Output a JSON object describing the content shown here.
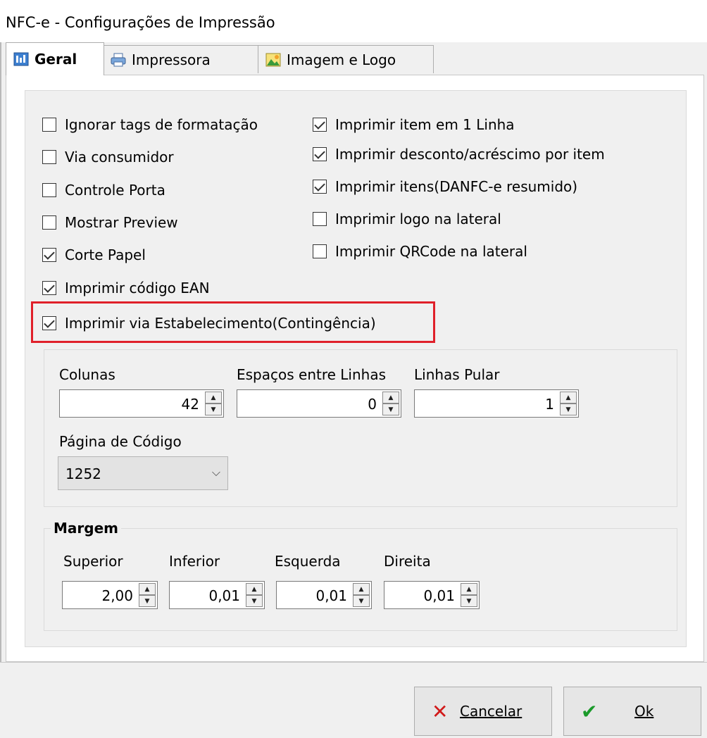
{
  "window": {
    "title": "NFC-e - Configurações de Impressão"
  },
  "tabs": [
    {
      "label": "Geral",
      "icon": "settings-grid-icon",
      "active": true
    },
    {
      "label": "Impressora",
      "icon": "printer-icon",
      "active": false
    },
    {
      "label": "Imagem e Logo",
      "icon": "image-icon",
      "active": false
    }
  ],
  "options": {
    "ignorar_tags": {
      "label": "Ignorar tags de formatação",
      "checked": false
    },
    "via_consumidor": {
      "label": "Via consumidor",
      "checked": false
    },
    "controle_porta": {
      "label": "Controle Porta",
      "checked": false
    },
    "mostrar_preview": {
      "label": "Mostrar Preview",
      "checked": false
    },
    "corte_papel": {
      "label": "Corte Papel",
      "checked": true
    },
    "imprimir_ean": {
      "label": "Imprimir código EAN",
      "checked": true
    },
    "imprimir_via_estab": {
      "label": "Imprimir via Estabelecimento(Contingência)",
      "checked": true
    },
    "imprimir_item_1_linha": {
      "label": "Imprimir item em 1 Linha",
      "checked": true
    },
    "imprimir_desconto": {
      "label": "Imprimir desconto/acréscimo por item",
      "checked": true
    },
    "imprimir_itens_resumido": {
      "label": "Imprimir itens(DANFC-e resumido)",
      "checked": true
    },
    "imprimir_logo_lateral": {
      "label": "Imprimir logo na lateral",
      "checked": false
    },
    "imprimir_qrcode_lateral": {
      "label": "Imprimir QRCode na lateral",
      "checked": false
    }
  },
  "layout_fields": {
    "colunas": {
      "label": "Colunas",
      "value": "42"
    },
    "espacos": {
      "label": "Espaços entre Linhas",
      "value": "0"
    },
    "linhas_pular": {
      "label": "Linhas Pular",
      "value": "1"
    },
    "pagina_codigo": {
      "label": "Página de Código",
      "value": "1252"
    }
  },
  "margem": {
    "title": "Margem",
    "superior": {
      "label": "Superior",
      "value": "2,00"
    },
    "inferior": {
      "label": "Inferior",
      "value": "0,01"
    },
    "esquerda": {
      "label": "Esquerda",
      "value": "0,01"
    },
    "direita": {
      "label": "Direita",
      "value": "0,01"
    }
  },
  "buttons": {
    "cancel": {
      "label": "Cancelar",
      "icon": "close-x-icon",
      "icon_color": "#d11a1a"
    },
    "ok": {
      "label": "Ok",
      "icon": "checkmark-icon",
      "icon_color": "#1a9a2a"
    }
  },
  "highlight_color": "#e0202a"
}
